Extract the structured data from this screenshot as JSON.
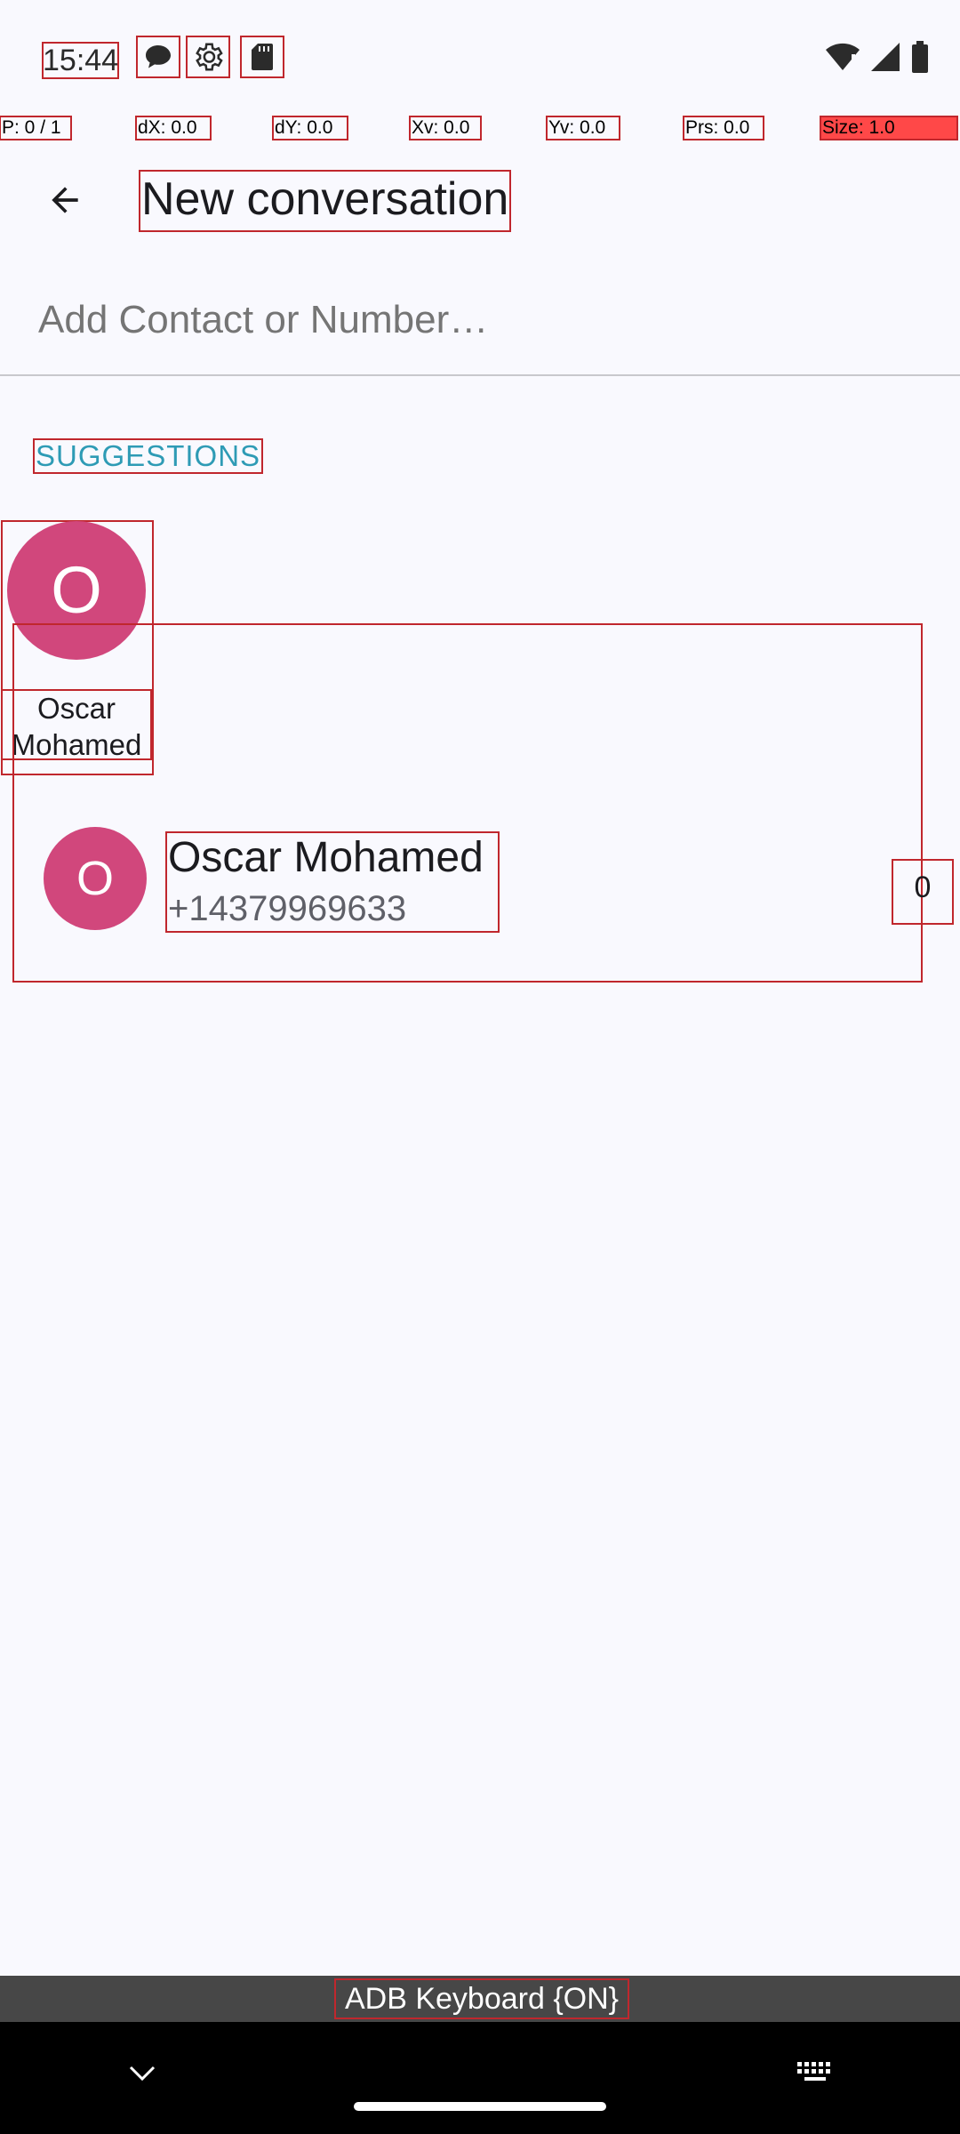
{
  "status_bar": {
    "time": "15:44",
    "notification_icons": [
      "chat-bubble-icon",
      "settings-gear-icon",
      "sd-card-icon"
    ],
    "system_icons": [
      "wifi-icon",
      "cell-signal-icon",
      "battery-icon"
    ]
  },
  "pointer_overlay": {
    "p": "P: 0 / 1",
    "dx": "dX: 0.0",
    "dy": "dY: 0.0",
    "xv": "Xv: 0.0",
    "yv": "Yv: 0.0",
    "prs": "Prs: 0.0",
    "size": "Size: 1.0"
  },
  "app_bar": {
    "back_icon": "arrow-back-icon",
    "title": "New conversation"
  },
  "recipient": {
    "placeholder": "Add Contact or Number…",
    "value": ""
  },
  "suggestions": {
    "header": "SUGGESTIONS",
    "items": [
      {
        "initial": "O",
        "name": "Oscar Mohamed"
      }
    ]
  },
  "contacts": [
    {
      "initial": "O",
      "name": "Oscar Mohamed",
      "number": "+14379969633",
      "type": "0"
    }
  ],
  "colors": {
    "avatar": "#d1477c",
    "accent": "#2e9bb5",
    "background": "#f9f9fe"
  },
  "keyboard_bar": {
    "label": "ADB Keyboard {ON}"
  },
  "nav_bar": {
    "icons": [
      "chevron-down-icon",
      "home-handle",
      "keyboard-icon"
    ]
  }
}
